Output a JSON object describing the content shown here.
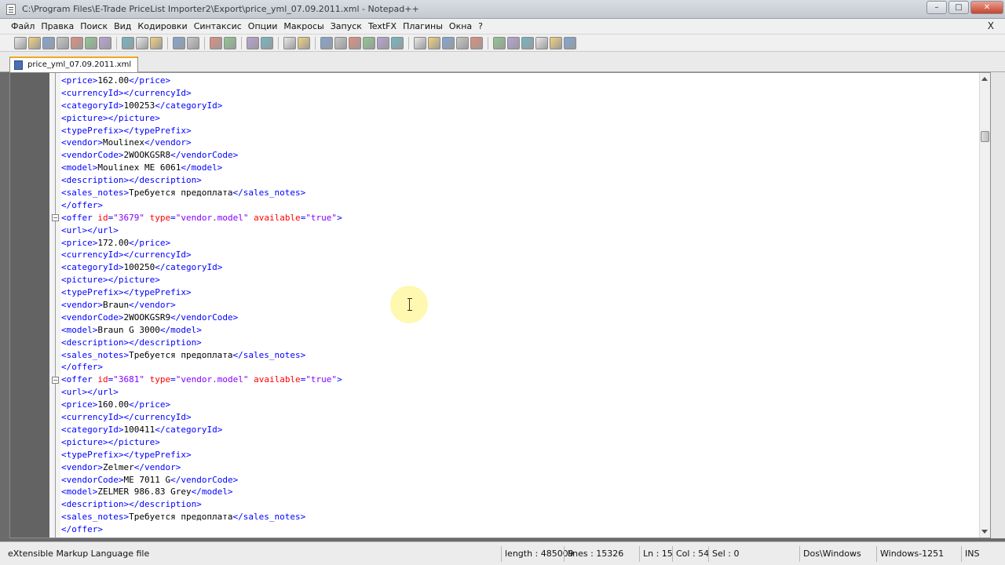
{
  "window": {
    "title": "C:\\Program Files\\E-Trade PriceList Importer2\\Export\\price_yml_07.09.2011.xml - Notepad++",
    "minimize": "–",
    "maximize": "□",
    "close": "✕"
  },
  "menu": {
    "items": [
      "Файл",
      "Правка",
      "Поиск",
      "Вид",
      "Кодировки",
      "Синтаксис",
      "Опции",
      "Макросы",
      "Запуск",
      "TextFX",
      "Плагины",
      "Окна",
      "?"
    ],
    "doc_close": "X"
  },
  "toolbar": {
    "buttons": [
      "new-file-icon",
      "open-file-icon",
      "save-icon",
      "save-all-icon",
      "close-icon",
      "close-all-icon",
      "print-icon",
      "cut-icon",
      "copy-icon",
      "paste-icon",
      "undo-icon",
      "redo-icon",
      "find-icon",
      "replace-icon",
      "zoom-in-icon",
      "zoom-out-icon",
      "sync-v-icon",
      "sync-h-icon",
      "word-wrap-icon",
      "show-all-icon",
      "indent-guide-icon",
      "udl-icon",
      "doc-map-icon",
      "function-list-icon",
      "record-icon",
      "stop-icon",
      "play-icon",
      "run-multiple-icon",
      "save-macro-icon",
      "textfx-1-icon",
      "textfx-2-icon",
      "textfx-3-icon",
      "textfx-4-icon",
      "textfx-5-icon",
      "textfx-6-icon"
    ]
  },
  "tab": {
    "label": "price_yml_07.09.2011.xml"
  },
  "editor": {
    "lines": [
      {
        "indent": "",
        "parts": [
          [
            "c",
            "<price>"
          ],
          [
            "t",
            "162.00"
          ],
          [
            "c",
            "</price>"
          ]
        ]
      },
      {
        "indent": "",
        "parts": [
          [
            "c",
            "<currencyId></currencyId>"
          ]
        ]
      },
      {
        "indent": "",
        "parts": [
          [
            "c",
            "<categoryId>"
          ],
          [
            "t",
            "100253"
          ],
          [
            "c",
            "</categoryId>"
          ]
        ]
      },
      {
        "indent": "",
        "parts": [
          [
            "c",
            "<picture></picture>"
          ]
        ]
      },
      {
        "indent": "",
        "parts": [
          [
            "c",
            "<typePrefix></typePrefix>"
          ]
        ]
      },
      {
        "indent": "",
        "parts": [
          [
            "c",
            "<vendor>"
          ],
          [
            "t",
            "Moulinex"
          ],
          [
            "c",
            "</vendor>"
          ]
        ]
      },
      {
        "indent": "",
        "parts": [
          [
            "c",
            "<vendorCode>"
          ],
          [
            "t",
            "2WOOKGSR8"
          ],
          [
            "c",
            "</vendorCode>"
          ]
        ]
      },
      {
        "indent": "",
        "parts": [
          [
            "c",
            "<model>"
          ],
          [
            "t",
            "Moulinex ME 6061"
          ],
          [
            "c",
            "</model>"
          ]
        ]
      },
      {
        "indent": "",
        "parts": [
          [
            "c",
            "<description></description>"
          ]
        ]
      },
      {
        "indent": "",
        "parts": [
          [
            "c",
            "<sales_notes>"
          ],
          [
            "t",
            "Требуется предоплата"
          ],
          [
            "c",
            "</sales_notes>"
          ]
        ]
      },
      {
        "indent": "",
        "parts": [
          [
            "c",
            "</offer>"
          ]
        ]
      },
      {
        "indent": "",
        "parts": [
          [
            "c",
            "<offer "
          ],
          [
            "attr",
            "id"
          ],
          [
            "c",
            "="
          ],
          [
            "val",
            "\"3679\""
          ],
          [
            "c",
            " "
          ],
          [
            "attr",
            "type"
          ],
          [
            "c",
            "="
          ],
          [
            "val",
            "\"vendor.model\""
          ],
          [
            "c",
            " "
          ],
          [
            "attr",
            "available"
          ],
          [
            "c",
            "="
          ],
          [
            "val",
            "\"true\""
          ],
          [
            "c",
            ">"
          ]
        ]
      },
      {
        "indent": "",
        "parts": [
          [
            "c",
            "<url></url>"
          ]
        ]
      },
      {
        "indent": "",
        "parts": [
          [
            "c",
            "<price>"
          ],
          [
            "t",
            "172.00"
          ],
          [
            "c",
            "</price>"
          ]
        ]
      },
      {
        "indent": "",
        "parts": [
          [
            "c",
            "<currencyId></currencyId>"
          ]
        ]
      },
      {
        "indent": "",
        "parts": [
          [
            "c",
            "<categoryId>"
          ],
          [
            "t",
            "100250"
          ],
          [
            "c",
            "</categoryId>"
          ]
        ]
      },
      {
        "indent": "",
        "parts": [
          [
            "c",
            "<picture></picture>"
          ]
        ]
      },
      {
        "indent": "",
        "parts": [
          [
            "c",
            "<typePrefix></typePrefix>"
          ]
        ]
      },
      {
        "indent": "",
        "parts": [
          [
            "c",
            "<vendor>"
          ],
          [
            "t",
            "Braun"
          ],
          [
            "c",
            "</vendor>"
          ]
        ]
      },
      {
        "indent": "",
        "parts": [
          [
            "c",
            "<vendorCode>"
          ],
          [
            "t",
            "2WOOKGSR9"
          ],
          [
            "c",
            "</vendorCode>"
          ]
        ]
      },
      {
        "indent": "",
        "parts": [
          [
            "c",
            "<model>"
          ],
          [
            "t",
            "Braun G 3000"
          ],
          [
            "c",
            "</model>"
          ]
        ]
      },
      {
        "indent": "",
        "parts": [
          [
            "c",
            "<description></description>"
          ]
        ]
      },
      {
        "indent": "",
        "parts": [
          [
            "c",
            "<sales_notes>"
          ],
          [
            "t",
            "Требуется предоплата"
          ],
          [
            "c",
            "</sales_notes>"
          ]
        ]
      },
      {
        "indent": "",
        "parts": [
          [
            "c",
            "</offer>"
          ]
        ]
      },
      {
        "indent": "",
        "parts": [
          [
            "c",
            "<offer "
          ],
          [
            "attr",
            "id"
          ],
          [
            "c",
            "="
          ],
          [
            "val",
            "\"3681\""
          ],
          [
            "c",
            " "
          ],
          [
            "attr",
            "type"
          ],
          [
            "c",
            "="
          ],
          [
            "val",
            "\"vendor.model\""
          ],
          [
            "c",
            " "
          ],
          [
            "attr",
            "available"
          ],
          [
            "c",
            "="
          ],
          [
            "val",
            "\"true\""
          ],
          [
            "c",
            ">"
          ]
        ]
      },
      {
        "indent": "",
        "parts": [
          [
            "c",
            "<url></url>"
          ]
        ]
      },
      {
        "indent": "",
        "parts": [
          [
            "c",
            "<price>"
          ],
          [
            "t",
            "160.00"
          ],
          [
            "c",
            "</price>"
          ]
        ]
      },
      {
        "indent": "",
        "parts": [
          [
            "c",
            "<currencyId></currencyId>"
          ]
        ]
      },
      {
        "indent": "",
        "parts": [
          [
            "c",
            "<categoryId>"
          ],
          [
            "t",
            "100411"
          ],
          [
            "c",
            "</categoryId>"
          ]
        ]
      },
      {
        "indent": "",
        "parts": [
          [
            "c",
            "<picture></picture>"
          ]
        ]
      },
      {
        "indent": "",
        "parts": [
          [
            "c",
            "<typePrefix></typePrefix>"
          ]
        ]
      },
      {
        "indent": "",
        "parts": [
          [
            "c",
            "<vendor>"
          ],
          [
            "t",
            "Zelmer"
          ],
          [
            "c",
            "</vendor>"
          ]
        ]
      },
      {
        "indent": "",
        "parts": [
          [
            "c",
            "<vendorCode>"
          ],
          [
            "t",
            "ME 7011 G"
          ],
          [
            "c",
            "</vendorCode>"
          ]
        ]
      },
      {
        "indent": "",
        "parts": [
          [
            "c",
            "<model>"
          ],
          [
            "t",
            "ZELMER 986.83 Grey"
          ],
          [
            "c",
            "</model>"
          ]
        ]
      },
      {
        "indent": "",
        "parts": [
          [
            "c",
            "<description></description>"
          ]
        ]
      },
      {
        "indent": "",
        "parts": [
          [
            "c",
            "<sales_notes>"
          ],
          [
            "t",
            "Требуется предоплата"
          ],
          [
            "c",
            "</sales_notes>"
          ]
        ]
      },
      {
        "indent": "",
        "parts": [
          [
            "c",
            "</offer>"
          ]
        ]
      }
    ],
    "fold_lines": [
      11,
      24
    ]
  },
  "status": {
    "file_type": "eXtensible Markup Language file",
    "length": "length : 485009",
    "lines": "lines : 15326",
    "ln": "Ln : 15",
    "col": "Col : 54",
    "sel": "Sel : 0",
    "eol": "Dos\\Windows",
    "encoding": "Windows-1251",
    "mode": "INS"
  },
  "colors": {
    "tag": "#0000ff",
    "attribute": "#ff0000",
    "attribute_value": "#8000ff",
    "text": "#000000",
    "active_tab_accent": "#f2a81d"
  }
}
